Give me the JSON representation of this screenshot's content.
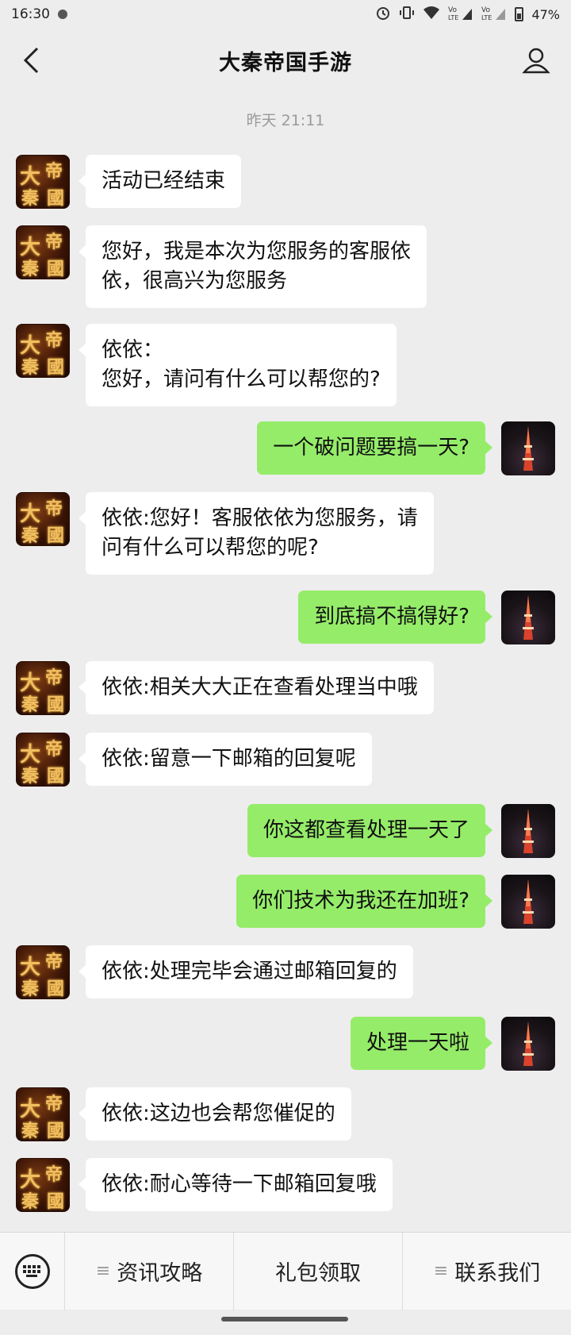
{
  "status_bar": {
    "time": "16:30",
    "battery_percent": "47%",
    "icons": [
      "alarm-icon",
      "vibrate-icon",
      "wifi-icon",
      "volte-signal-icon",
      "volte-signal-icon",
      "battery-icon"
    ]
  },
  "header": {
    "title": "大秦帝国手游",
    "back_icon": "chevron-left-icon",
    "profile_icon": "person-icon"
  },
  "timestamp": "昨天 21:11",
  "colors": {
    "background": "#ededed",
    "incoming_bubble": "#ffffff",
    "outgoing_bubble": "#95ec69"
  },
  "avatars": {
    "game_glyphs": [
      "大",
      "秦",
      "帝",
      "國"
    ]
  },
  "messages": [
    {
      "side": "left",
      "text": "活动已经结束"
    },
    {
      "side": "left",
      "text": "您好，我是本次为您服务的客服依\n依，很高兴为您服务"
    },
    {
      "side": "left",
      "text": "依依：\n您好，请问有什么可以帮您的?"
    },
    {
      "side": "right",
      "text": "一个破问题要搞一天?"
    },
    {
      "side": "left",
      "text": "依依:您好！客服依依为您服务，请\n问有什么可以帮您的呢?"
    },
    {
      "side": "right",
      "text": "到底搞不搞得好?"
    },
    {
      "side": "left",
      "text": "依依:相关大大正在查看处理当中哦"
    },
    {
      "side": "left",
      "text": "依依:留意一下邮箱的回复呢"
    },
    {
      "side": "right",
      "text": "你这都查看处理一天了"
    },
    {
      "side": "right",
      "text": "你们技术为我还在加班?"
    },
    {
      "side": "left",
      "text": "依依:处理完毕会通过邮箱回复的"
    },
    {
      "side": "right",
      "text": "处理一天啦"
    },
    {
      "side": "left",
      "text": "依依:这边也会帮您催促的"
    },
    {
      "side": "left",
      "text": "依依:耐心等待一下邮箱回复哦"
    }
  ],
  "bottom_menu": {
    "keyboard_icon": "keyboard-icon",
    "items": [
      {
        "label": "资讯攻略",
        "has_submenu": true
      },
      {
        "label": "礼包领取",
        "has_submenu": false
      },
      {
        "label": "联系我们",
        "has_submenu": true
      }
    ]
  }
}
